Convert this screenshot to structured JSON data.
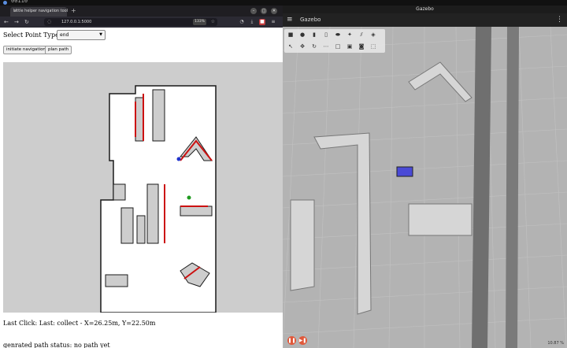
{
  "desktop": {
    "workspace_label": "00110"
  },
  "browser": {
    "tab_title": "Little helper navigation tool",
    "url": "127.0.0.1:5000",
    "zoom": "133%",
    "page": {
      "select_label": "Select Point Type:",
      "select_value": "end",
      "buttons": {
        "initiate": "initiate navigation",
        "plan": "plan path"
      },
      "last_click": "Last Click: Last: collect - X=26.25m, Y=22.50m",
      "path_status": "genrated path status: no path yet"
    }
  },
  "gazebo": {
    "window_title": "Gazebo",
    "app_name": "Gazebo",
    "status": "10.87 %",
    "colors": {
      "ground": "#b3b3b3",
      "robot": "#4a4ad6",
      "obstacle": "#d6d6d6"
    }
  },
  "map_colors": {
    "free": "#ffffff",
    "unknown": "#cdcdcd",
    "wall": "#1a1a1a",
    "path": "#cc1111",
    "robot_dot": "#1f9a1f",
    "goal_dot": "#2233cc"
  }
}
